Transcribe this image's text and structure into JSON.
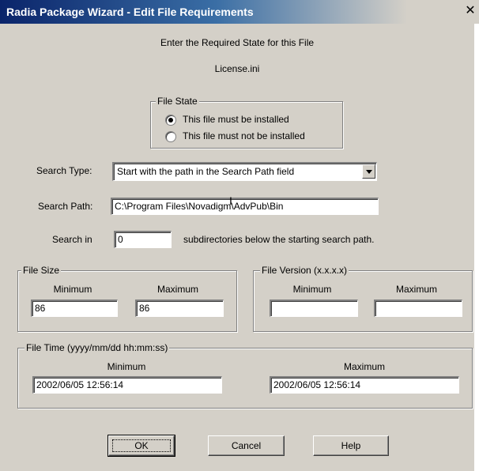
{
  "window": {
    "title": "Radia Package Wizard - Edit File Requirements",
    "close_glyph": "✕"
  },
  "header": {
    "instruction": "Enter the Required State for this File",
    "file_name": "License.ini"
  },
  "file_state": {
    "legend": "File State",
    "options": [
      {
        "label": "This file must be installed",
        "checked": true
      },
      {
        "label": "This file must not be installed",
        "checked": false
      }
    ]
  },
  "search_type": {
    "label": "Search Type:",
    "value": "Start with the path in the Search Path field"
  },
  "search_path": {
    "label": "Search Path:",
    "value": "C:\\Program Files\\Novadigm\\AdvPub\\Bin"
  },
  "search_in": {
    "label": "Search in",
    "value": "0",
    "suffix": "subdirectories below the starting search path."
  },
  "file_size": {
    "legend": "File Size",
    "min_label": "Minimum",
    "max_label": "Maximum",
    "min_value": "86",
    "max_value": "86"
  },
  "file_version": {
    "legend": "File Version (x.x.x.x)",
    "min_label": "Minimum",
    "max_label": "Maximum",
    "min_value": "",
    "max_value": ""
  },
  "file_time": {
    "legend": "File Time (yyyy/mm/dd hh:mm:ss)",
    "min_label": "Minimum",
    "max_label": "Maximum",
    "min_value": "2002/06/05 12:56:14",
    "max_value": "2002/06/05 12:56:14"
  },
  "buttons": {
    "ok": "OK",
    "cancel": "Cancel",
    "help": "Help"
  },
  "colors": {
    "titlebar_start": "#0a246a",
    "dialog_face": "#d4d0c8"
  }
}
